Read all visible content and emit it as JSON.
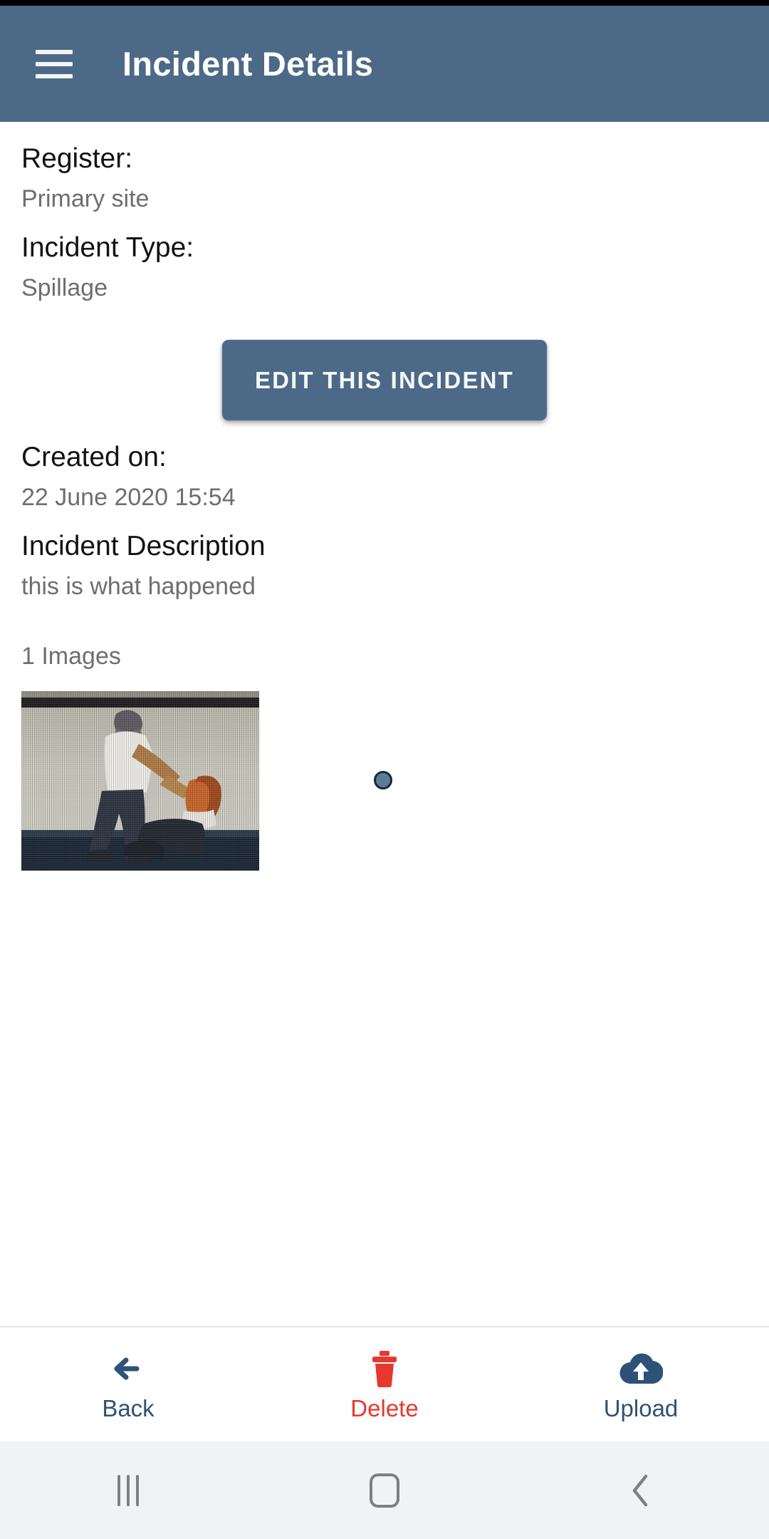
{
  "appbar": {
    "menu_icon": "hamburger-menu-icon",
    "title": "Incident Details",
    "background_color": "#4c6a87"
  },
  "fields": [
    {
      "label": "Register:",
      "value": "Primary site"
    },
    {
      "label": "Incident Type:",
      "value": "Spillage"
    }
  ],
  "edit_button": {
    "label": "EDIT THIS INCIDENT",
    "background_color": "#4c6a87",
    "text_color": "#f4f7f9"
  },
  "fields_after": [
    {
      "label": "Created on:",
      "value": "22 June 2020 15:54"
    },
    {
      "label": "Incident Description",
      "value": "this is what happened"
    }
  ],
  "images": {
    "count_label": "1 Images",
    "thumbnail_alt": "incident-photo",
    "page_indicator_color": "#5b7c9b"
  },
  "bottom_bar": {
    "items": [
      {
        "label": "Back",
        "icon": "arrow-left-icon",
        "color": "#2e5277"
      },
      {
        "label": "Delete",
        "icon": "trash-icon",
        "color": "#e8372c"
      },
      {
        "label": "Upload",
        "icon": "cloud-upload-icon",
        "color": "#2e5277"
      }
    ]
  },
  "system_nav": {
    "items": [
      {
        "name": "recents",
        "icon": "recents-icon"
      },
      {
        "name": "home",
        "icon": "home-icon"
      },
      {
        "name": "back",
        "icon": "chevron-left-icon"
      }
    ]
  }
}
